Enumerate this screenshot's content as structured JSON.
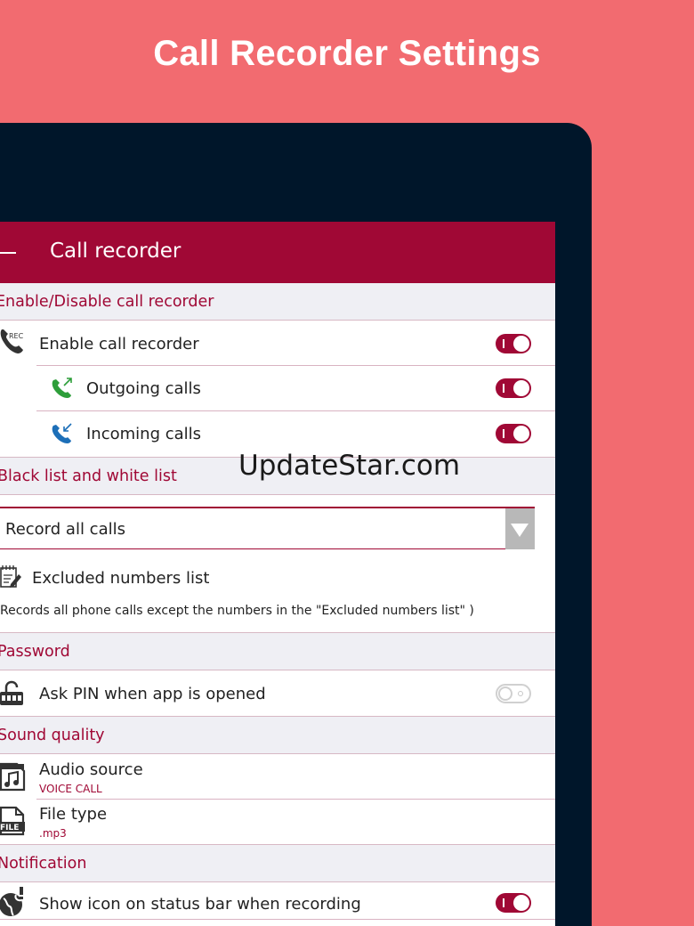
{
  "headline": "Call Recorder Settings",
  "appbar": {
    "title": "Call recorder"
  },
  "watermark": "UpdateStar.com",
  "sections": {
    "enable": "Enable/Disable call recorder",
    "lists": "Black list and white list",
    "password": "Password",
    "sound": "Sound quality",
    "notification": "Notification"
  },
  "rows": {
    "enable_recorder": {
      "label": "Enable call recorder",
      "state": "on"
    },
    "outgoing": {
      "label": "Outgoing calls",
      "state": "on"
    },
    "incoming": {
      "label": "Incoming calls",
      "state": "on"
    },
    "record_mode": {
      "value": "Record all calls"
    },
    "excluded": {
      "label": "Excluded numbers list"
    },
    "description": "Records all phone calls except the numbers in the \"Excluded numbers list\" )",
    "ask_pin": {
      "label": "Ask PIN when app is opened",
      "state": "off"
    },
    "audio_source": {
      "label": "Audio source",
      "value": "VOICE CALL"
    },
    "file_type": {
      "label": "File type",
      "value": ".mp3"
    },
    "status_icon": {
      "label": "Show icon on status bar when recording",
      "state": "on"
    }
  },
  "icons": {
    "rec_badge": "REC",
    "file_badge": "FILE"
  },
  "colors": {
    "background": "#f26b70",
    "device": "#00162a",
    "accent": "#a00835",
    "section_bg": "#efeff4",
    "outgoing_icon": "#2e9e3a",
    "incoming_icon": "#1d6fb8"
  }
}
